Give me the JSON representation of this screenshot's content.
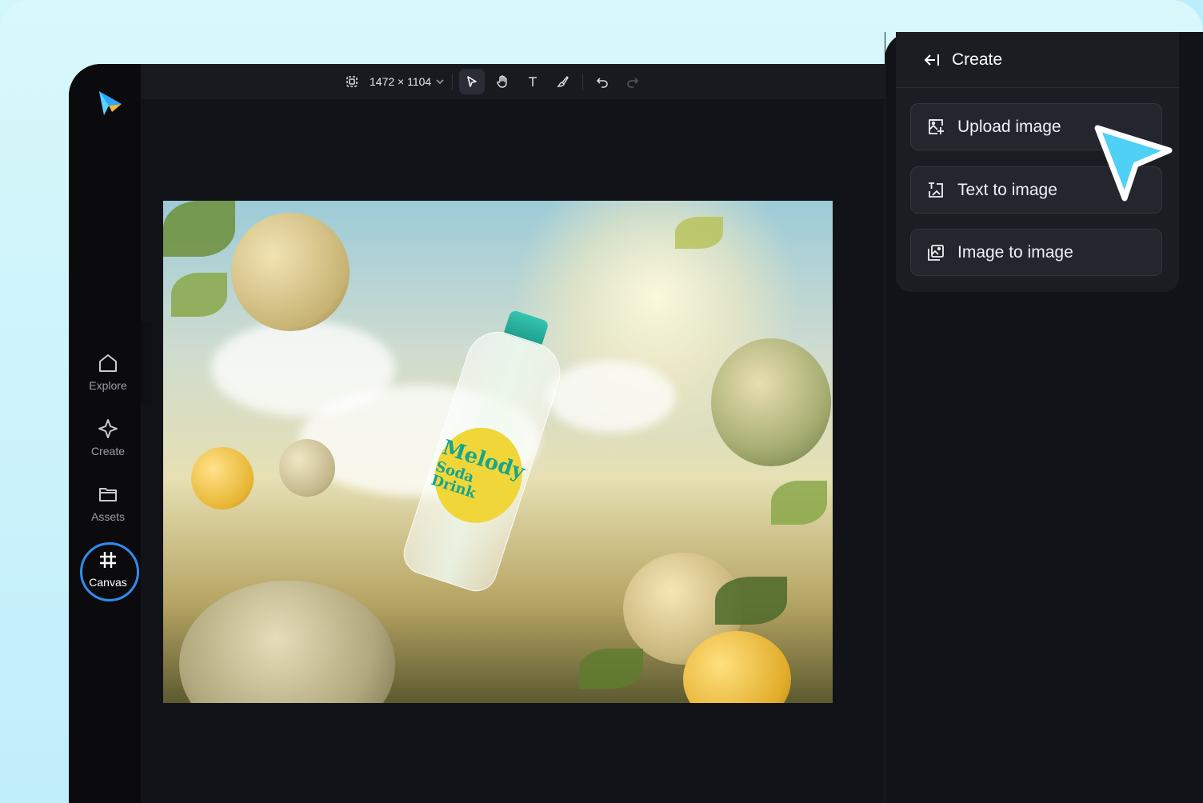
{
  "toolbar": {
    "canvas_size": "1472 × 1104"
  },
  "sidebar": {
    "items": [
      {
        "label": "Explore",
        "icon": "home-icon"
      },
      {
        "label": "Create",
        "icon": "sparkle-icon"
      },
      {
        "label": "Assets",
        "icon": "folder-icon"
      },
      {
        "label": "Canvas",
        "icon": "hash-icon",
        "active": true
      }
    ]
  },
  "canvas": {
    "product_text_line1": "Melody",
    "product_text_line2": "Soda Drink"
  },
  "create_panel": {
    "title": "Create",
    "actions": [
      {
        "label": "Upload image",
        "icon": "upload-image-icon"
      },
      {
        "label": "Text to image",
        "icon": "text-to-image-icon"
      },
      {
        "label": "Image to image",
        "icon": "image-to-image-icon"
      }
    ]
  },
  "colors": {
    "accent": "#2f8cf0",
    "cursor": "#4fd0f5",
    "panel_bg": "#1b1d23",
    "app_bg": "#121318"
  }
}
